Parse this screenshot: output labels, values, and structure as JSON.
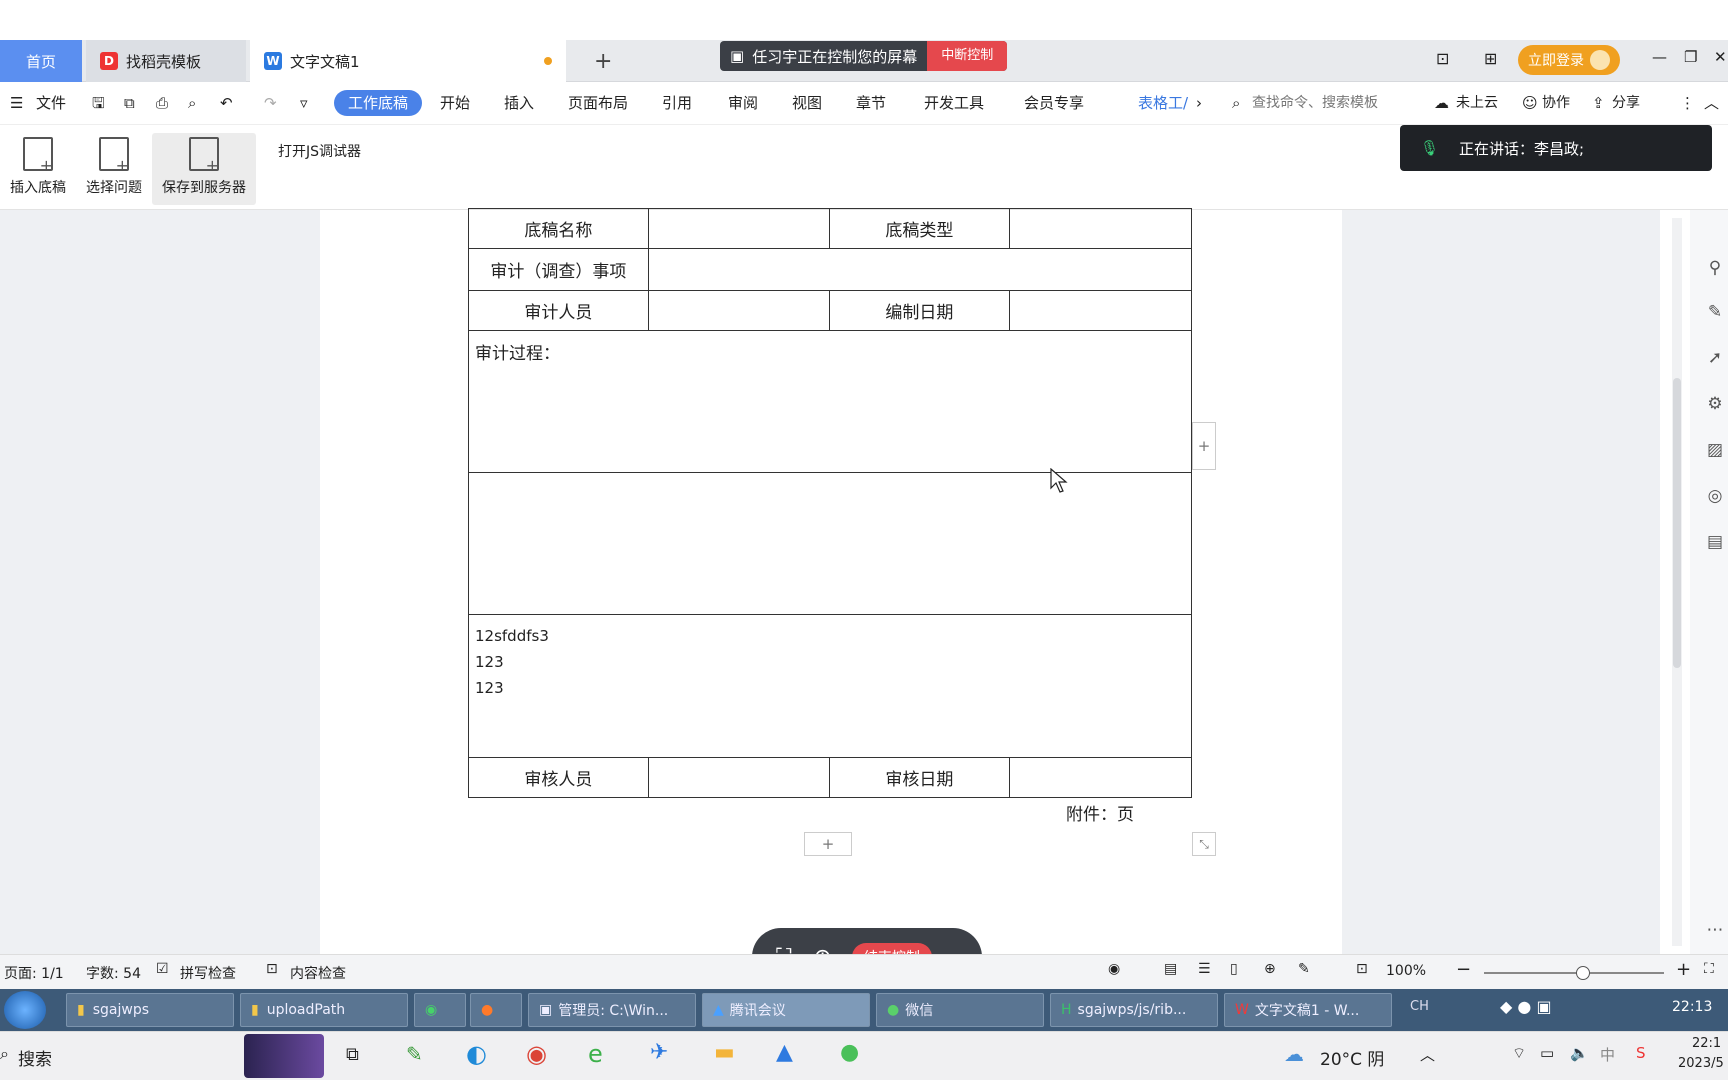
{
  "tabs": {
    "home": "首页",
    "template": "找稻壳模板",
    "doc": "文字文稿1",
    "add": "+"
  },
  "control_banner": {
    "text": "任习宇正在控制您的屏幕",
    "stop": "中断控制"
  },
  "top_right": {
    "login": "立即登录",
    "minimize": "—",
    "restore": "❐",
    "close": "✕"
  },
  "menu": {
    "file": "文件",
    "items": [
      "工作底稿",
      "开始",
      "插入",
      "页面布局",
      "引用",
      "审阅",
      "视图",
      "章节",
      "开发工具",
      "会员专享"
    ],
    "table_tools": "表格工/",
    "search": "查找命令、搜索模板",
    "cloud": "未上云",
    "collab": "协作",
    "share": "分享"
  },
  "ribbon": {
    "insert": "插入底稿",
    "select": "选择问题",
    "save": "保存到服务器",
    "js": "打开JS调试器"
  },
  "speaking": {
    "text": "正在讲话：李昌政;"
  },
  "doc_table": {
    "r1": [
      "底稿名称",
      "",
      "底稿类型",
      ""
    ],
    "r2": [
      "审计（调查）事项",
      ""
    ],
    "r3": [
      "审计人员",
      "",
      "编制日期",
      ""
    ],
    "process_label": "审计过程：",
    "lines": [
      "12sfddfs3",
      "123",
      "123"
    ],
    "r_last": [
      "审核人员",
      "",
      "审核日期",
      ""
    ],
    "attach": "附件：页"
  },
  "floating": {
    "end": "结束控制"
  },
  "status": {
    "page": "页面: 1/1",
    "words": "字数: 54",
    "spell": "拼写检查",
    "content": "内容检查",
    "zoom": "100%",
    "zoom_level": 0.55
  },
  "taskbar": {
    "items": [
      "sgajwps",
      "uploadPath",
      "",
      "",
      "管理员: C:\\Win...",
      "腾讯会议",
      "微信",
      "sgajwps/js/rib...",
      "文字文稿1 - W..."
    ],
    "lang": "CH",
    "time": "22:13"
  },
  "taskbar2": {
    "search": "搜索",
    "weather": "20°C 阴",
    "time": "22:1",
    "date": "2023/5"
  }
}
